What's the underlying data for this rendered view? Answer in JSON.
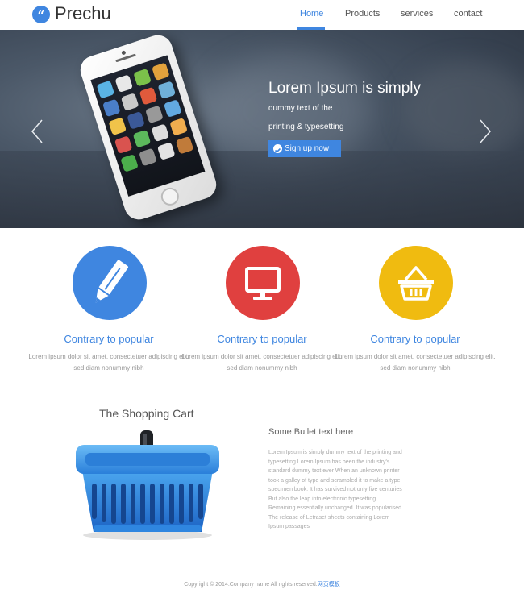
{
  "brand": {
    "mark": "“",
    "name": "Prechu"
  },
  "nav": [
    {
      "label": "Home",
      "active": true
    },
    {
      "label": "Products"
    },
    {
      "label": "services"
    },
    {
      "label": "contact"
    }
  ],
  "hero": {
    "title": "Lorem Ipsum is simply",
    "line1": "dummy text of the",
    "line2": "printing & typesetting",
    "cta": "Sign up now"
  },
  "features": [
    {
      "icon": "pencil-icon",
      "color": "#3f86e0",
      "title": "Contrary to popular",
      "desc": "Lorem ipsum dolor sit amet, consectetuer adipiscing elit, sed diam nonummy nibh"
    },
    {
      "icon": "monitor-icon",
      "color": "#e0403f",
      "title": "Contrary to popular",
      "desc": "Lorem ipsum dolor sit amet, consectetuer adipiscing elit, sed diam nonummy nibh"
    },
    {
      "icon": "basket-icon",
      "color": "#f0bb10",
      "title": "Contrary to popular",
      "desc": "Lorem ipsum dolor sit amet, consectetuer adipiscing elit, sed diam nonummy nibh"
    }
  ],
  "shopping": {
    "title": "The Shopping Cart",
    "bullet_title": "Some Bullet text here",
    "bullet_body": "Lorem Ipsum is simply dummy text of the printing and typesetting Lorem Ipsum has been the industry's standard dummy text ever When an unknown printer took a galley of type and scrambled it to make a type specimen book. It has survived not only five centuries But also the leap into electronic typesetting. Remaining essentially unchanged. It was popularised The release of Letraset sheets containing Lorem Ipsum passages"
  },
  "footer": {
    "text": "Copyright © 2014.Company name All rights reserved.",
    "link": "网页模板"
  },
  "colors": {
    "accent": "#3f86e0",
    "red": "#e0403f",
    "yellow": "#f0bb10"
  }
}
